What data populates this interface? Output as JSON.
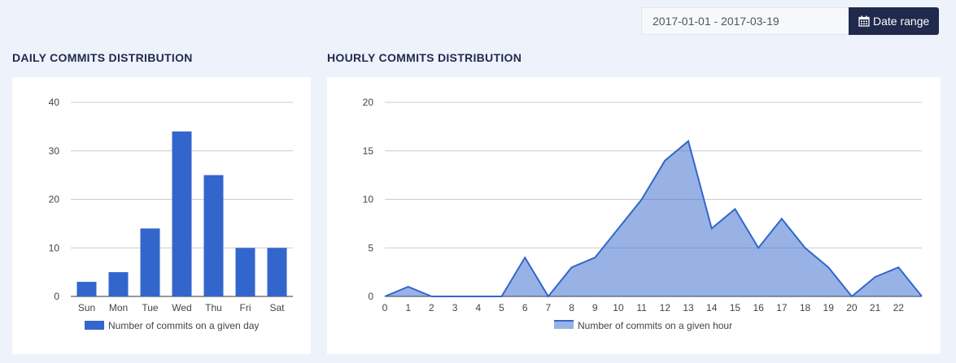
{
  "date_range": {
    "value": "2017-01-01 - 2017-03-19",
    "button_label": "Date range",
    "icon": "calendar-icon"
  },
  "accent": "#3366cc",
  "charts": {
    "daily": {
      "title": "DAILY COMMITS DISTRIBUTION"
    },
    "hourly": {
      "title": "HOURLY COMMITS DISTRIBUTION"
    }
  },
  "chart_data": [
    {
      "type": "bar",
      "title": "DAILY COMMITS DISTRIBUTION",
      "categories": [
        "Sun",
        "Mon",
        "Tue",
        "Wed",
        "Thu",
        "Fri",
        "Sat"
      ],
      "series": [
        {
          "name": "Number of commits on a given day",
          "values": [
            3,
            5,
            14,
            34,
            25,
            10,
            10
          ]
        }
      ],
      "ylim": [
        0,
        40
      ],
      "yticks": [
        0,
        10,
        20,
        30,
        40
      ],
      "grid": true,
      "legend": "bottom",
      "color": "#3366cc"
    },
    {
      "type": "area",
      "title": "HOURLY COMMITS DISTRIBUTION",
      "x": [
        0,
        1,
        2,
        3,
        4,
        5,
        6,
        7,
        8,
        9,
        10,
        11,
        12,
        13,
        14,
        15,
        16,
        17,
        18,
        19,
        20,
        21,
        22,
        23
      ],
      "xticks": [
        0,
        1,
        2,
        3,
        4,
        5,
        6,
        7,
        8,
        9,
        10,
        11,
        12,
        13,
        14,
        15,
        16,
        17,
        18,
        19,
        20,
        21,
        22
      ],
      "series": [
        {
          "name": "Number of commits on a given hour",
          "values": [
            0,
            1,
            0,
            0,
            0,
            0,
            4,
            0,
            3,
            4,
            7,
            10,
            14,
            16,
            7,
            9,
            5,
            8,
            5,
            3,
            0,
            2,
            3,
            0
          ]
        }
      ],
      "ylim": [
        0,
        20
      ],
      "yticks": [
        0,
        5,
        10,
        15,
        20
      ],
      "grid": true,
      "legend": "bottom",
      "color": "#3366cc"
    }
  ]
}
